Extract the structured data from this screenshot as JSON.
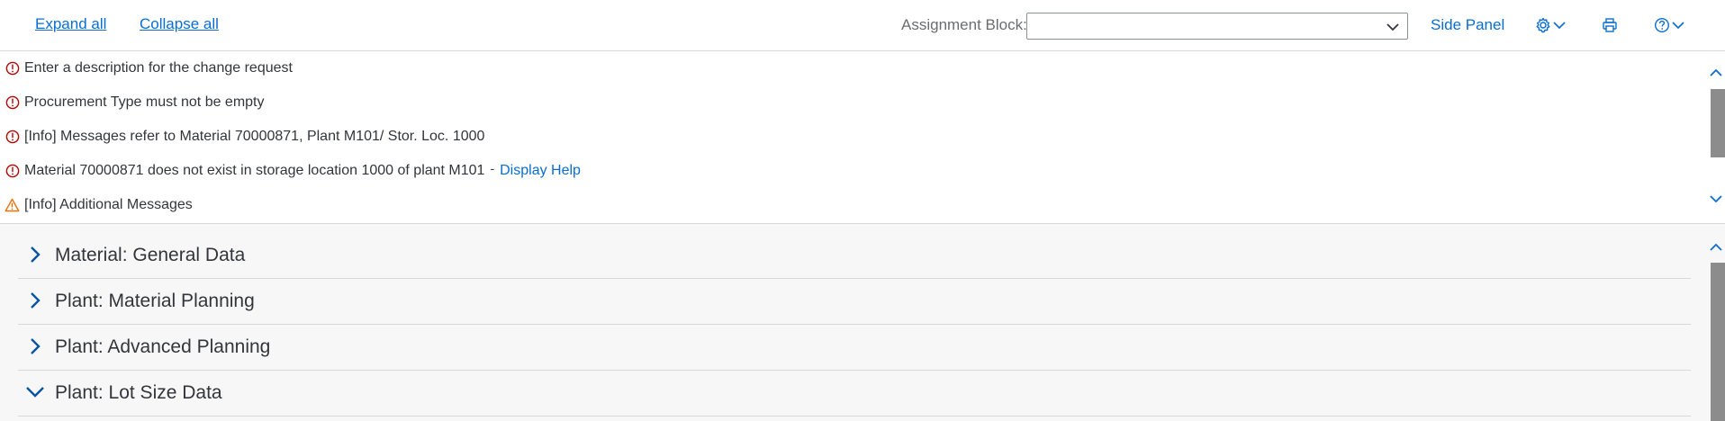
{
  "toolbar": {
    "expand_all": "Expand all",
    "collapse_all": "Collapse all",
    "assignment_block_label": "Assignment Block:",
    "assignment_block_value": "",
    "side_panel": "Side Panel",
    "icons": [
      "settings-icon",
      "print-icon",
      "help-icon"
    ]
  },
  "messages": [
    {
      "type": "error",
      "text": "Enter a description for the change request"
    },
    {
      "type": "error",
      "text": "Procurement Type must not be empty"
    },
    {
      "type": "error",
      "text": "[Info] Messages refer to Material 70000871, Plant M101/ Stor. Loc. 1000"
    },
    {
      "type": "error",
      "text": "Material 70000871 does not exist in storage location 1000 of plant M101",
      "separator": "-",
      "link": "Display Help"
    },
    {
      "type": "warning",
      "text": "[Info] Additional Messages"
    }
  ],
  "sections": [
    {
      "title": "Material: General Data",
      "expanded": false
    },
    {
      "title": "Plant: Material Planning",
      "expanded": false
    },
    {
      "title": "Plant: Advanced Planning",
      "expanded": false
    },
    {
      "title": "Plant: Lot Size Data",
      "expanded": true
    }
  ],
  "colors": {
    "link": "#0a6ed1",
    "error": "#bb0000",
    "warning": "#e9730c",
    "text": "#32363a",
    "section_bg": "#f7f7f7"
  }
}
